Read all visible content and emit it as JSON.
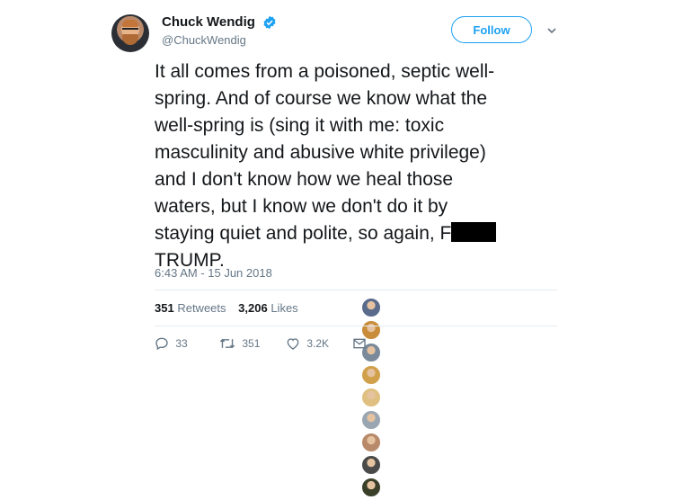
{
  "author": {
    "display_name": "Chuck Wendig",
    "handle": "@ChuckWendig",
    "verified": true
  },
  "follow_button": {
    "label": "Follow"
  },
  "menu": {
    "icon": "chevron-down-icon"
  },
  "tweet": {
    "text_lines": [
      "It all comes from a poisoned, septic well-",
      "spring. And of course we know what the",
      "well-spring is (sing it with me: toxic",
      "masculinity and abusive white privilege)",
      "and I don't know how we heal those",
      "waters, but I know we don't do it by",
      "staying quiet and polite, so again, F",
      "TRUMP."
    ],
    "timestamp": "6:43 AM - 15 Jun 2018"
  },
  "stats": {
    "retweets_count": "351",
    "retweets_label": "Retweets",
    "likes_count": "3,206",
    "likes_label": "Likes",
    "liker_avatar_colors": [
      "#5a6b8c",
      "#c98c3a",
      "#7a8a9a",
      "#d1a04a",
      "#e0c080",
      "#9aa6b2",
      "#b88a6a",
      "#4a4a4a",
      "#3a3f2a"
    ]
  },
  "actions": {
    "reply_count": "33",
    "retweet_count": "351",
    "like_count": "3.2K",
    "icons": [
      "reply-icon",
      "retweet-icon",
      "heart-icon",
      "direct-message-icon"
    ]
  },
  "colors": {
    "accent": "#1da1f2",
    "text": "#14171a",
    "muted": "#657786",
    "divider": "#e6ecf0"
  }
}
